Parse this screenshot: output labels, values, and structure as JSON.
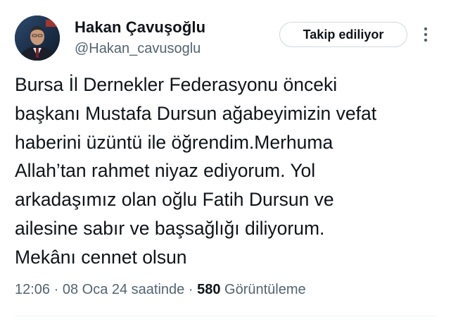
{
  "author": {
    "display_name": "Hakan Çavuşoğlu",
    "handle": "@Hakan_cavusoglu",
    "avatar_icon": "profile-photo"
  },
  "follow_button": {
    "label": "Takip ediliyor"
  },
  "more_menu": {
    "icon": "vertical-ellipsis-icon"
  },
  "tweet": {
    "lines": [
      "Bursa İl Dernekler Federasyonu önceki",
      "başkanı Mustafa Dursun ağabeyimizin vefat",
      "haberini üzüntü ile öğrendim.Merhuma",
      "Allah’tan rahmet niyaz ediyorum. Yol",
      "arkadaşımız olan oğlu Fatih Dursun ve",
      "ailesine sabır ve başsağlığı diliyorum.",
      "Mekânı cennet olsun"
    ]
  },
  "meta": {
    "time": "12:06",
    "separator": " · ",
    "date": "08 Oca 24 saatinde",
    "views_count": "580",
    "views_label": "Görüntüleme"
  },
  "colors": {
    "text_primary": "#0f1419",
    "text_secondary": "#536471",
    "border": "#cfd9de"
  }
}
